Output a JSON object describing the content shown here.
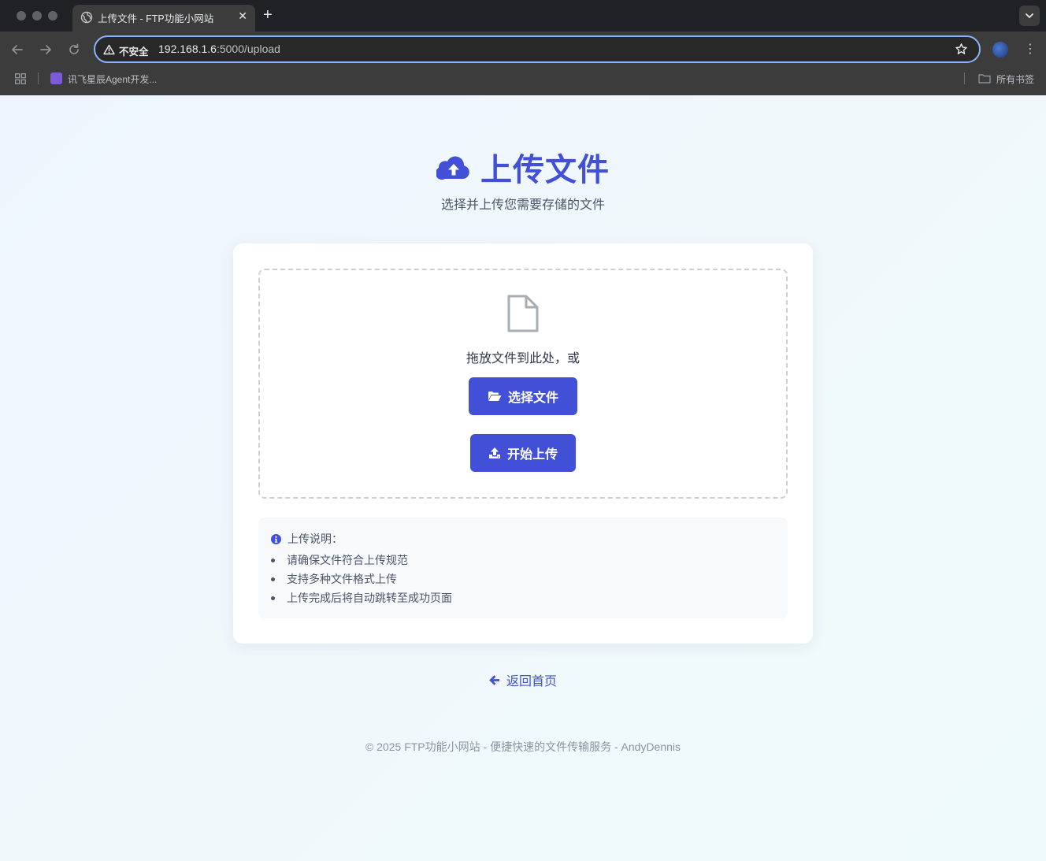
{
  "browser": {
    "tab_title": "上传文件 - FTP功能小网站",
    "new_tab": "+",
    "tab_close": "✕",
    "security_label": "不安全",
    "url_host": "192.168.1.6",
    "url_path": ":5000/upload",
    "bookmarks": [
      {
        "label": "讯飞星辰Agent开发..."
      }
    ],
    "all_bookmarks": "所有书签",
    "menu": "⋮"
  },
  "page": {
    "title": "上传文件",
    "subtitle": "选择并上传您需要存储的文件",
    "dropzone": {
      "text": "拖放文件到此处，或",
      "choose_label": "选择文件",
      "upload_label": "开始上传"
    },
    "info": {
      "heading": "上传说明：",
      "items": [
        "请确保文件符合上传规范",
        "支持多种文件格式上传",
        "上传完成后将自动跳转至成功页面"
      ]
    },
    "back_link": "返回首页",
    "footer": "© 2025 FTP功能小网站 - 便捷快速的文件传输服务 - AndyDennis"
  },
  "colors": {
    "primary": "#4150d6",
    "page_background": "#eef5fe",
    "card_background": "#ffffff",
    "info_background": "#f7f9fb"
  },
  "icons": {
    "title": "cloud-upload-icon",
    "dropzone": "file-icon",
    "choose_button": "folder-open-icon",
    "upload_button": "upload-icon",
    "info": "info-circle-icon",
    "back": "arrow-left-icon"
  }
}
